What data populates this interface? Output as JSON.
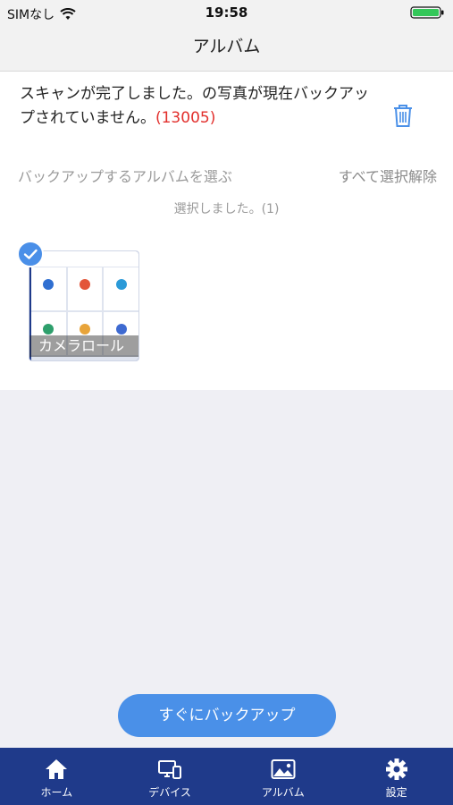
{
  "status_bar": {
    "carrier": "SIMなし",
    "time": "19:58"
  },
  "nav": {
    "title": "アルバム"
  },
  "scan": {
    "message": "スキャンが完了しました。の写真が現在バックアップされていません。",
    "count": "(13005)"
  },
  "album_section": {
    "choose_label": "バックアップするアルバムを選ぶ",
    "deselect_all": "すべて選択解除",
    "selected_text": "選択しました。(1)"
  },
  "albums": [
    {
      "name": "カメラロール",
      "selected": true
    }
  ],
  "backup_button": {
    "label": "すぐにバックアップ"
  },
  "tabs": [
    {
      "label": "ホーム",
      "icon": "home-icon"
    },
    {
      "label": "デバイス",
      "icon": "devices-icon"
    },
    {
      "label": "アルバム",
      "icon": "album-icon"
    },
    {
      "label": "設定",
      "icon": "gear-icon"
    }
  ],
  "colors": {
    "accent": "#4a90e8",
    "tabbar": "#1f3a8a",
    "count_red": "#e2302d"
  }
}
